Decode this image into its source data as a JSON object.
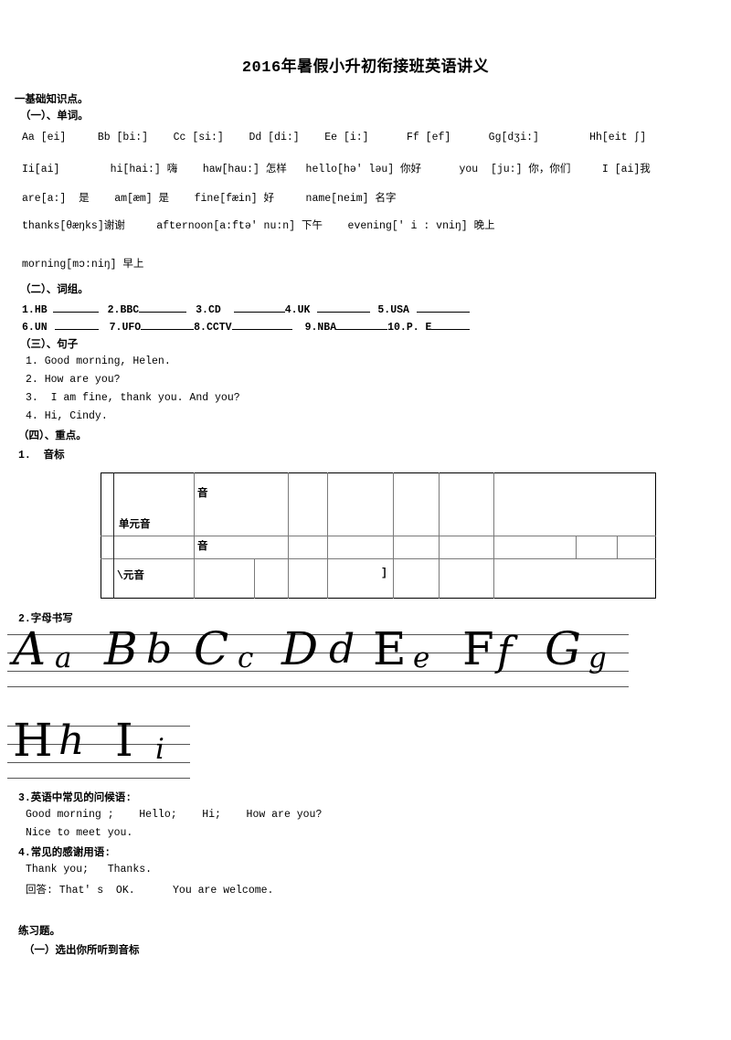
{
  "document": {
    "title": "2016年暑假小升初衔接班英语讲义"
  },
  "sections": {
    "basic_heading": "一基础知识点。",
    "part1_heading": "（一）、单词。",
    "part2_heading": "（二）、词组。",
    "part3_heading": "（三）、句子",
    "part4_heading": "（四）、重点。"
  },
  "alphabet": {
    "line1": "Aa [ei]     Bb [bi:]    Cc [si:]    Dd [di:]    Ee [i:]      Ff [ef]      Gg[dʒi:]        Hh[eit ʃ]",
    "line2": "Ii[ai]        hi[hai:] 嗨    haw[hau:] 怎样   hello[hə' ləu] 你好      you  [ju:] 你，你们     I [ai]我",
    "line3": "are[a:]  是    am[æm] 是    fine[fæin] 好     name[neim] 名字",
    "line4": "thanks[θæŋks]谢谢     afternoon[a:ftə' nu:n] 下午    evening[' i : vniŋ] 晚上",
    "line5": "morning[mɔ:niŋ] 早上"
  },
  "word_groups": {
    "row1": [
      {
        "num": "1.",
        "label": "HB"
      },
      {
        "num": "2.",
        "label": "BBC"
      },
      {
        "num": "3.",
        "label": "CD"
      },
      {
        "num": "4.",
        "label": "UK"
      },
      {
        "num": "5.",
        "label": "USA"
      }
    ],
    "row2": [
      {
        "num": "6.",
        "label": "UN"
      },
      {
        "num": "7.",
        "label": "UFO"
      },
      {
        "num": "8.",
        "label": "CCTV"
      },
      {
        "num": "9.",
        "label": "NBA"
      },
      {
        "num": "10.",
        "label": "P. E"
      }
    ]
  },
  "sentences": [
    "1. Good morning, Helen.",
    "2. How are you?",
    "3.  I am fine, thank you. And you?",
    "4. Hi, Cindy."
  ],
  "key_points": {
    "item1_label": "1.  音标",
    "item2_label": "2.字母书写",
    "item3_label": "3.英语中常见的问候语:",
    "item4_label": "4.常见的感谢用语:"
  },
  "phonetic_table": {
    "row_label_1": "单元音",
    "row_label_2": "\\元音",
    "cell_a": "音",
    "cell_b": "音",
    "cell_c": "]"
  },
  "handwriting": {
    "row1": [
      "Aa",
      "Bb",
      "Cc",
      "Dd",
      "Ee",
      "Ff",
      "Gg"
    ],
    "row2": [
      "Hh",
      "Ii"
    ]
  },
  "greetings": {
    "line1": "Good morning ;    Hello;    Hi;    How are you?",
    "line2": "Nice to meet you."
  },
  "thanks": {
    "line1": "Thank you;   Thanks.",
    "line2": "回答: That' s  OK.      You are welcome."
  },
  "exercises": {
    "heading": "练习题。",
    "item1": "（一）选出你所听到音标"
  }
}
